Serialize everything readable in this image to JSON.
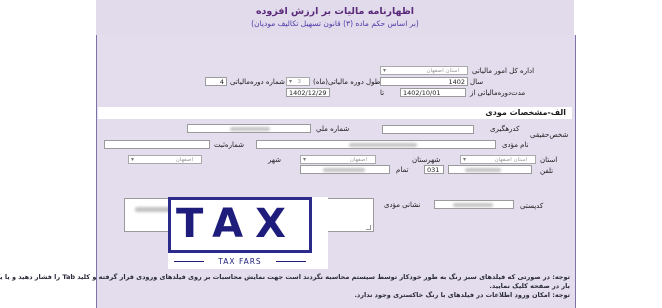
{
  "header": {
    "title": "اظهارنامه مالیات بر ارزش افزوده",
    "subtitle": "(بر اساس حکم ماده (۳) قانون تسهیل تکالیف مودیان)"
  },
  "period": {
    "tax_office_label": "اداره کل امور مالیاتی",
    "tax_office_value": "استان اصفهان",
    "year_label": "سال",
    "year_value": "1402",
    "length_label": "طول دوره مالیاتی(ماه)",
    "length_value": "3",
    "period_number_label": "شماره دوره‌مالیاتی",
    "period_number_value": "4",
    "range_label": "مدت‌دوره‌مالیاتی از",
    "from_value": "1402/10/01",
    "to_label": "تا",
    "to_value": "1402/12/29"
  },
  "section_a": {
    "title": "الف-مشخصات مودی"
  },
  "taxpayer": {
    "type_label": "شخص‌حقیقی",
    "business_code_label": "کدرهگیری",
    "national_id_label": "شماره ملي",
    "name_label": "نام مؤدی",
    "registration_label": "شماره‌ثبت",
    "province_label": "استان",
    "province_value": "استان اصفهان",
    "county_label": "شهرستان",
    "county_value": "اصفهان",
    "city_label": "شهر",
    "city_value": "اصفهان",
    "phone_label": "تلفن",
    "area_code_value": "031",
    "mobile_label": "تمام",
    "address_label": "نشانی مؤدی",
    "postal_code_label": "کدپستی"
  },
  "logo": {
    "word": "TAX",
    "sub": "TAX FARS"
  },
  "notes": {
    "line1": "توجه: در صورتی که فیلدهای سبز رنگ به طور خودکار  توسط سیستم محاسبه نگردند است جهت نمایش محاسبات بر روی فیلدهای ورودی قرار گرفته و کلید Tab را فشار دهید و یا یک",
    "line2": "بار در صفحه کلیک نمایید.",
    "line3": "توجه: امکان ورود اطلاعات در فیلدهای با رنگ خاکستری وجود ندارد."
  },
  "colors": {
    "header_bg": "#e2dbeb",
    "form_bg": "#e3dded",
    "title": "#5b2a7a",
    "logo": "#1f1d7c"
  }
}
